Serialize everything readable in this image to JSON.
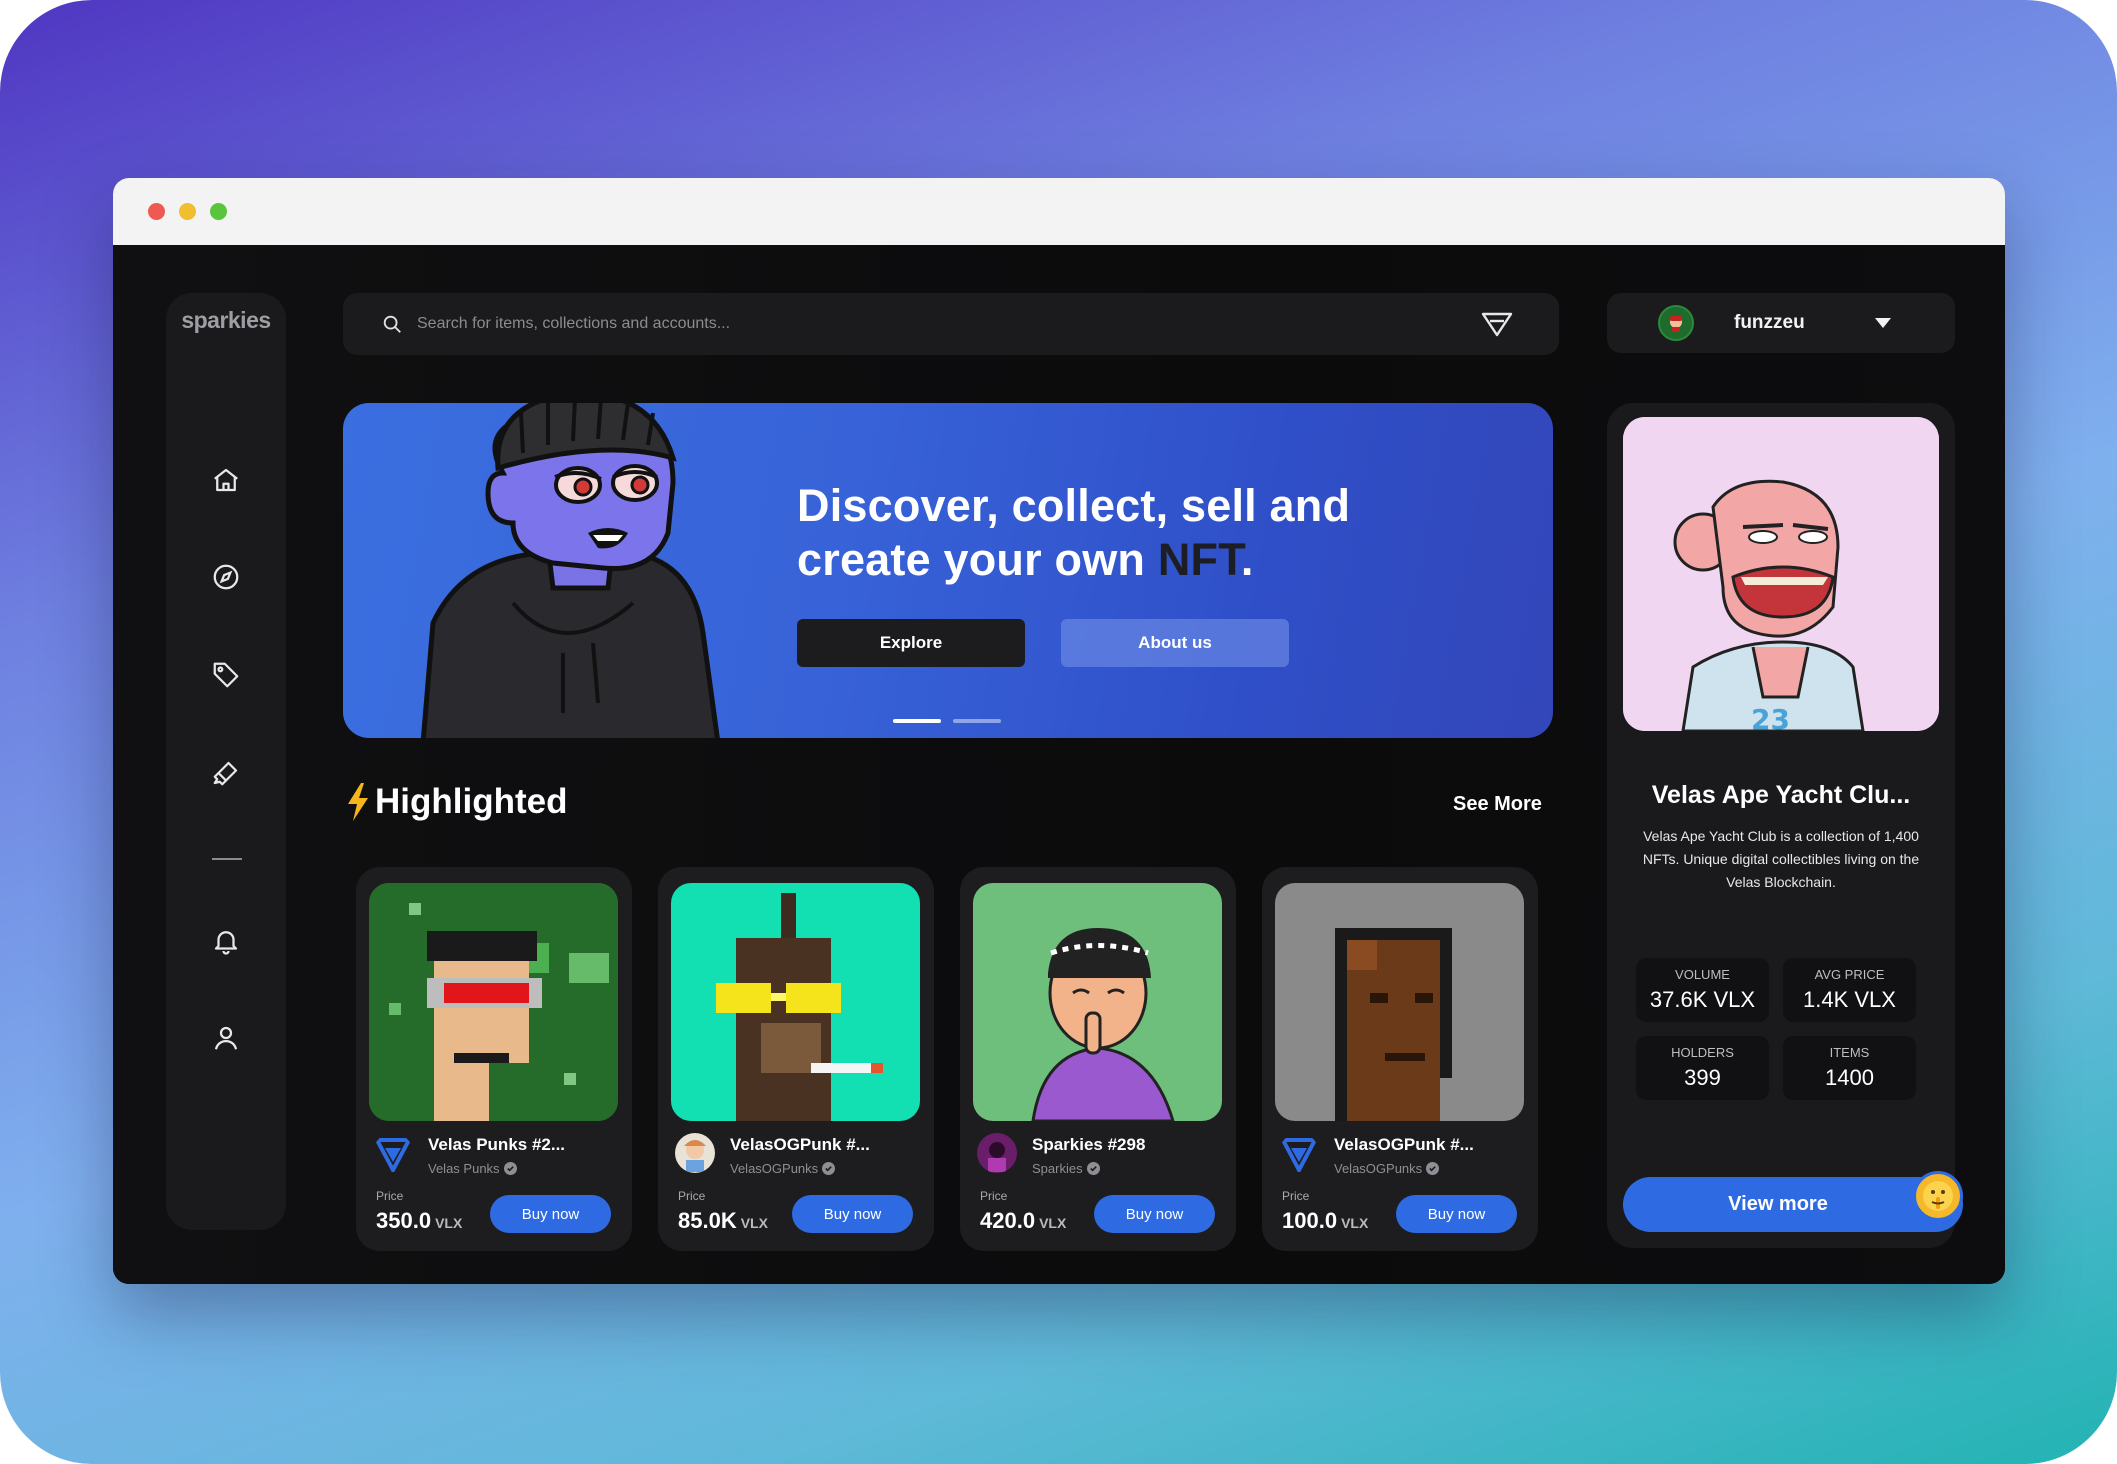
{
  "app": {
    "logo": "sparkies",
    "brand_color": "#2e6be2"
  },
  "window_controls": [
    "close",
    "minimize",
    "maximize"
  ],
  "sidebar": {
    "items": [
      {
        "icon": "home-icon"
      },
      {
        "icon": "compass-icon"
      },
      {
        "icon": "tag-icon"
      },
      {
        "icon": "brush-icon"
      },
      {
        "icon": "bell-icon"
      },
      {
        "icon": "user-icon"
      }
    ]
  },
  "search": {
    "placeholder": "Search for items, collections and accounts..."
  },
  "user": {
    "name": "funzzeu"
  },
  "hero": {
    "title_line1": "Discover, collect, sell and",
    "title_line2_prefix": "create your own ",
    "title_highlight": "NFT",
    "title_suffix": ".",
    "explore_label": "Explore",
    "about_label": "About us",
    "slides": 2,
    "active_slide": 1
  },
  "highlighted": {
    "title": "Highlighted",
    "see_more": "See More",
    "price_label": "Price",
    "buy_label": "Buy now",
    "currency": "VLX",
    "cards": [
      {
        "name": "Velas Punks #2...",
        "collection": "Velas Punks",
        "price": "350.0"
      },
      {
        "name": "VelasOGPunk #...",
        "collection": "VelasOGPunks",
        "price": "85.0K"
      },
      {
        "name": "Sparkies #298",
        "collection": "Sparkies",
        "price": "420.0"
      },
      {
        "name": "VelasOGPunk #...",
        "collection": "VelasOGPunks",
        "price": "100.0"
      }
    ]
  },
  "featured": {
    "title": "Velas Ape Yacht Clu...",
    "description": "Velas Ape Yacht Club is a collection of 1,400 NFTs. Unique digital collectibles living on the Velas Blockchain.",
    "stats": [
      {
        "label": "VOLUME",
        "value": "37.6K VLX"
      },
      {
        "label": "AVG PRICE",
        "value": "1.4K VLX"
      },
      {
        "label": "HOLDERS",
        "value": "399"
      },
      {
        "label": "ITEMS",
        "value": "1400"
      }
    ],
    "view_more": "View more"
  }
}
